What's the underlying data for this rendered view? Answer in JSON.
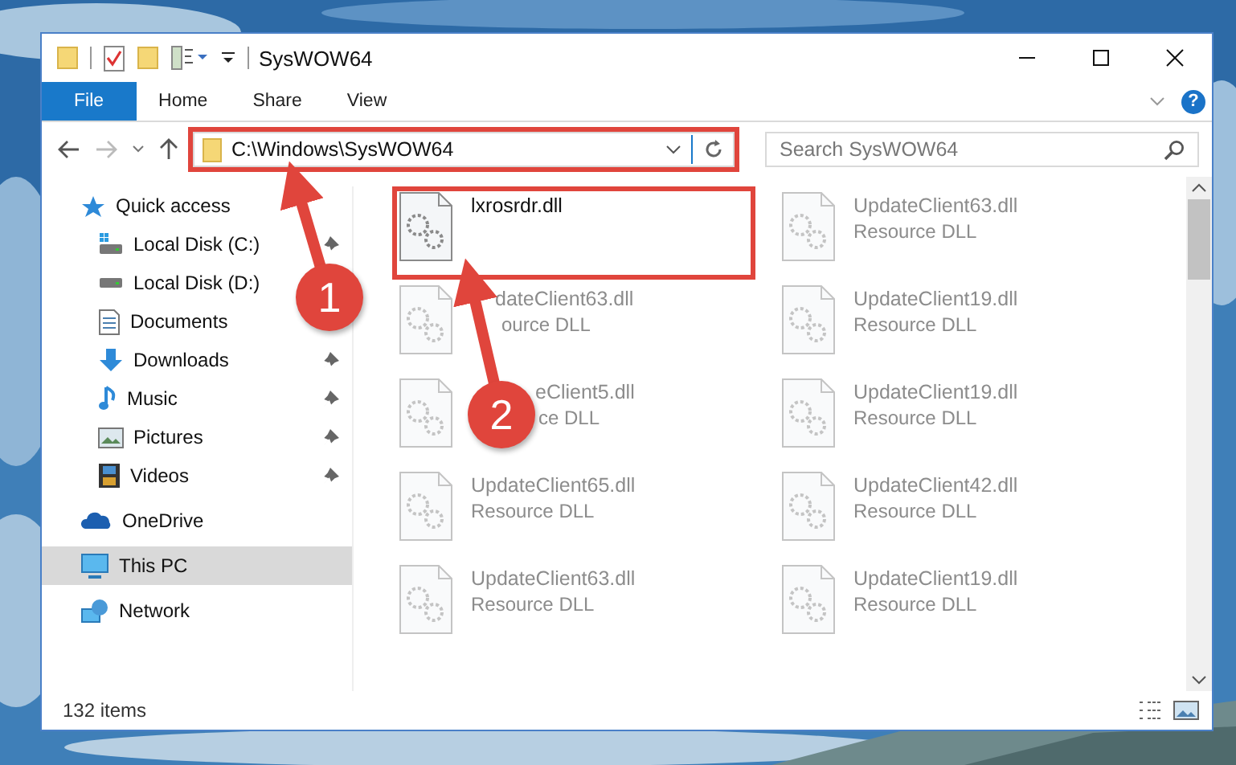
{
  "window": {
    "title": "SysWOW64"
  },
  "ribbon": {
    "tabs": [
      {
        "label": "File",
        "selected": true
      },
      {
        "label": "Home",
        "selected": false
      },
      {
        "label": "Share",
        "selected": false
      },
      {
        "label": "View",
        "selected": false
      }
    ],
    "help_label": "?"
  },
  "address_bar": {
    "path": "C:\\Windows\\SysWOW64",
    "highlighted": true
  },
  "search": {
    "placeholder": "Search SysWOW64"
  },
  "navigation": [
    {
      "label": "Quick access",
      "kind": "quick",
      "selected": false,
      "children": [
        {
          "label": "Local Disk (C:)",
          "kind": "drive-c",
          "pinned": true,
          "selected": false
        },
        {
          "label": "Local Disk (D:)",
          "kind": "drive",
          "pinned": false,
          "selected": false
        },
        {
          "label": "Documents",
          "kind": "documents",
          "pinned": false,
          "selected": false
        },
        {
          "label": "Downloads",
          "kind": "downloads",
          "pinned": true,
          "selected": false
        },
        {
          "label": "Music",
          "kind": "music",
          "pinned": true,
          "selected": false
        },
        {
          "label": "Pictures",
          "kind": "pictures",
          "pinned": true,
          "selected": false
        },
        {
          "label": "Videos",
          "kind": "videos",
          "pinned": true,
          "selected": false
        }
      ]
    },
    {
      "label": "OneDrive",
      "kind": "onedrive",
      "selected": false
    },
    {
      "label": "This PC",
      "kind": "pc",
      "selected": true
    },
    {
      "label": "Network",
      "kind": "network",
      "selected": false
    }
  ],
  "files": [
    {
      "name": "lxrosrdr.dll",
      "highlighted": true,
      "faded": false
    },
    {
      "name": "UpdateClient63.dll",
      "type": "Resource DLL",
      "highlighted": false,
      "faded": true
    },
    {
      "name": "dateClient63.dll",
      "type": "ource DLL",
      "highlighted": false,
      "faded": true
    },
    {
      "name": "UpdateClient19.dll",
      "type": "Resource DLL",
      "highlighted": false,
      "faded": true
    },
    {
      "name": "eClient5.dll",
      "type": "ce DLL",
      "highlighted": false,
      "faded": true
    },
    {
      "name": "UpdateClient19.dll",
      "type": "Resource DLL",
      "highlighted": false,
      "faded": true
    },
    {
      "name": "UpdateClient65.dll",
      "type": "Resource DLL",
      "highlighted": false,
      "faded": true
    },
    {
      "name": "UpdateClient42.dll",
      "type": "Resource DLL",
      "highlighted": false,
      "faded": true
    },
    {
      "name": "UpdateClient63.dll",
      "type": "Resource DLL",
      "highlighted": false,
      "faded": true
    },
    {
      "name": "UpdateClient19.dll",
      "type": "Resource DLL",
      "highlighted": false,
      "faded": true
    }
  ],
  "status_bar": {
    "item_count": "132 items"
  },
  "callouts": [
    {
      "number": "1"
    },
    {
      "number": "2"
    }
  ]
}
